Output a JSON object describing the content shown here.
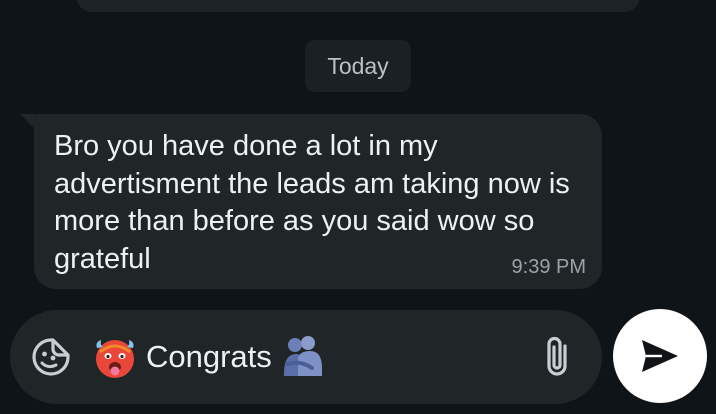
{
  "chat": {
    "date_separator": "Today",
    "messages": [
      {
        "text": "Bro you have done a lot in my advertisment the leads am taking now is more than before as you said wow so grateful",
        "time": "9:39 PM"
      }
    ]
  },
  "composer": {
    "text": "Congrats",
    "emojis": [
      "hot-face-emoji",
      "people-hugging-emoji"
    ],
    "icons": {
      "sticker": "sticker-icon",
      "attach": "paperclip-icon",
      "send": "send-icon"
    }
  },
  "colors": {
    "background": "#0f1418",
    "bubble": "#202628",
    "date_chip": "#1b2024",
    "text": "#eef1f3",
    "muted_text": "#9aa3aa",
    "send_button": "#ffffff"
  }
}
